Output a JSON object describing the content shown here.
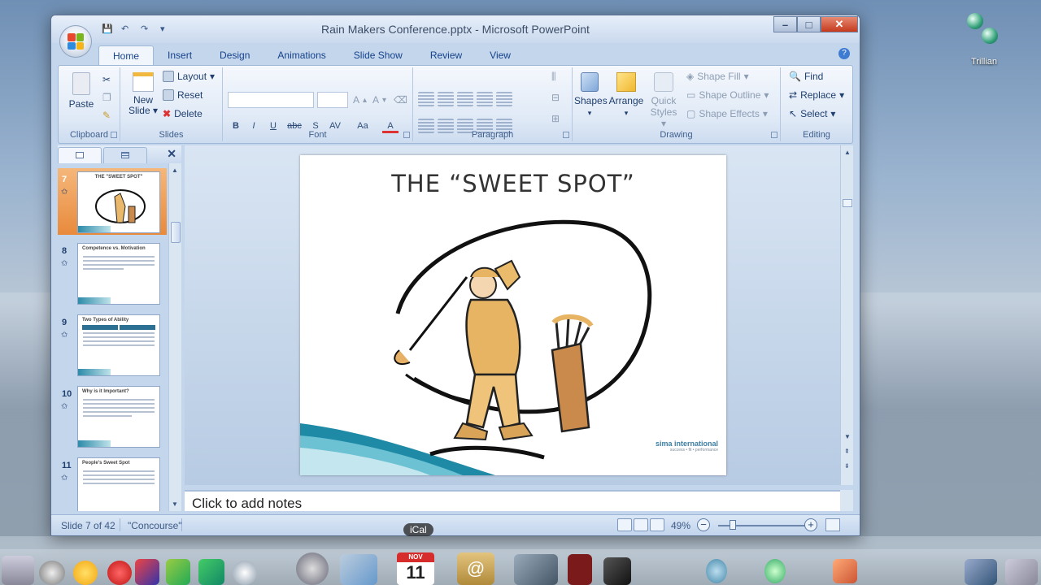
{
  "window": {
    "title": "Rain Makers Conference.pptx - Microsoft PowerPoint",
    "controls": {
      "minimize": "–",
      "maximize": "□",
      "close": "✕"
    }
  },
  "desktop": {
    "trillian_label": "Trillian",
    "ical_tooltip": "iCal",
    "ical_month": "NOV",
    "ical_day": "11"
  },
  "ribbon": {
    "tabs": [
      "Home",
      "Insert",
      "Design",
      "Animations",
      "Slide Show",
      "Review",
      "View"
    ],
    "active_tab": "Home",
    "clipboard": {
      "label": "Clipboard",
      "paste": "Paste"
    },
    "slides": {
      "label": "Slides",
      "new_slide_line1": "New",
      "new_slide_line2": "Slide",
      "layout": "Layout",
      "reset": "Reset",
      "delete": "Delete"
    },
    "font": {
      "label": "Font",
      "bold": "B",
      "italic": "I",
      "underline": "U",
      "strike": "abc",
      "shadow": "S",
      "spacing": "AV",
      "change_case": "Aa",
      "color": "A",
      "grow": "A",
      "shrink": "A"
    },
    "paragraph": {
      "label": "Paragraph"
    },
    "drawing": {
      "label": "Drawing",
      "shapes": "Shapes",
      "arrange": "Arrange",
      "quick_styles_line1": "Quick",
      "quick_styles_line2": "Styles",
      "shape_fill": "Shape Fill",
      "shape_outline": "Shape Outline",
      "shape_effects": "Shape Effects"
    },
    "editing": {
      "label": "Editing",
      "find": "Find",
      "replace": "Replace",
      "select": "Select"
    }
  },
  "thumbnails": [
    {
      "num": "7",
      "title": "THE \"SWEET SPOT\"",
      "selected": true
    },
    {
      "num": "8",
      "title": "Competence vs. Motivation",
      "selected": false
    },
    {
      "num": "9",
      "title": "Two Types of Ability",
      "selected": false
    },
    {
      "num": "10",
      "title": "Why is it Important?",
      "selected": false
    },
    {
      "num": "11",
      "title": "People's Sweet Spot",
      "selected": false
    }
  ],
  "slide": {
    "title": "THE “SWEET SPOT”",
    "logo_text": "sima international",
    "logo_tagline": "success • fit • performance"
  },
  "notes": {
    "placeholder": "Click to add notes"
  },
  "status": {
    "slide_info": "Slide 7 of 42",
    "theme": "\"Concourse\"",
    "zoom": "49%",
    "zoom_level_percent": 49
  }
}
